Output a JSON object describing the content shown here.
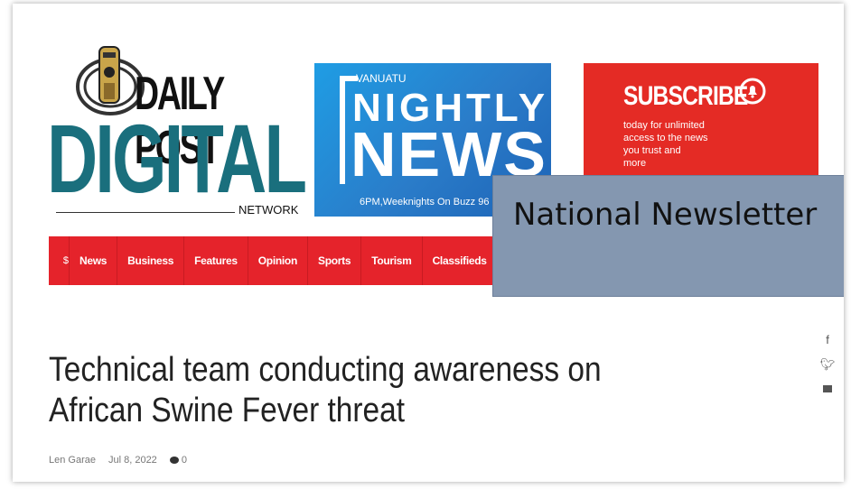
{
  "logo": {
    "title": "DAILY POST",
    "main": "DIGITAL",
    "sub": "NETWORK"
  },
  "news_banner": {
    "kicker": "VANUATU",
    "line1": "NIGHTLY",
    "line2": "NEWS.",
    "schedule": "6PM,Weeknights On Buzz 96"
  },
  "subscribe_banner": {
    "title": "SUBSCRIBE",
    "lines": [
      "today for unlimited",
      "access to the news",
      "you trust and",
      "more"
    ],
    "icon": "bell-icon"
  },
  "nav": {
    "items": [
      "News",
      "Business",
      "Features",
      "Opinion",
      "Sports",
      "Tourism",
      "Classifieds"
    ]
  },
  "overlay": {
    "text": "National Newsletter"
  },
  "article": {
    "headline": "Technical team conducting awareness on African Swine Fever threat",
    "author": "Len Garae",
    "date": "Jul 8, 2022",
    "comments": "0"
  },
  "share": {
    "icons": [
      "facebook-icon",
      "twitter-icon",
      "email-icon"
    ]
  },
  "colors": {
    "nav_red": "#e5232b",
    "logo_teal": "#1a6f7d",
    "news_blue": "#2a7cc9",
    "subscribe_red": "#e42b25",
    "overlay_blue_gray": "#8497b0"
  }
}
